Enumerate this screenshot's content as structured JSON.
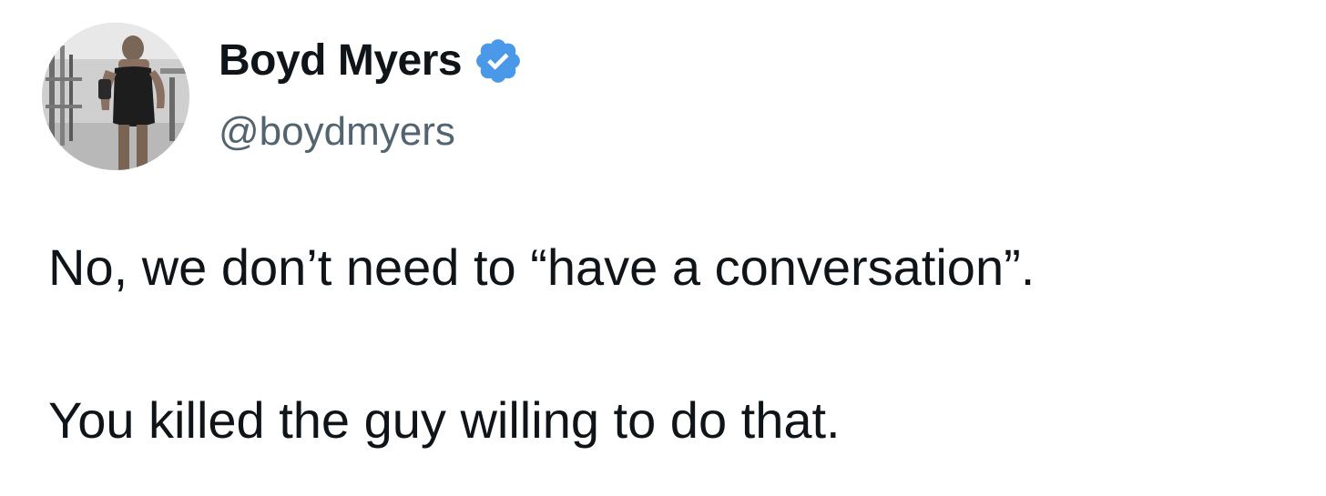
{
  "tweet": {
    "author": {
      "name": "Boyd Myers",
      "handle": "@boydmyers",
      "verified": true,
      "verified_color": "#4a99e9"
    },
    "text_lines": [
      "No, we don’t need to “have a conversation”.",
      "You killed the guy willing to do that."
    ]
  }
}
